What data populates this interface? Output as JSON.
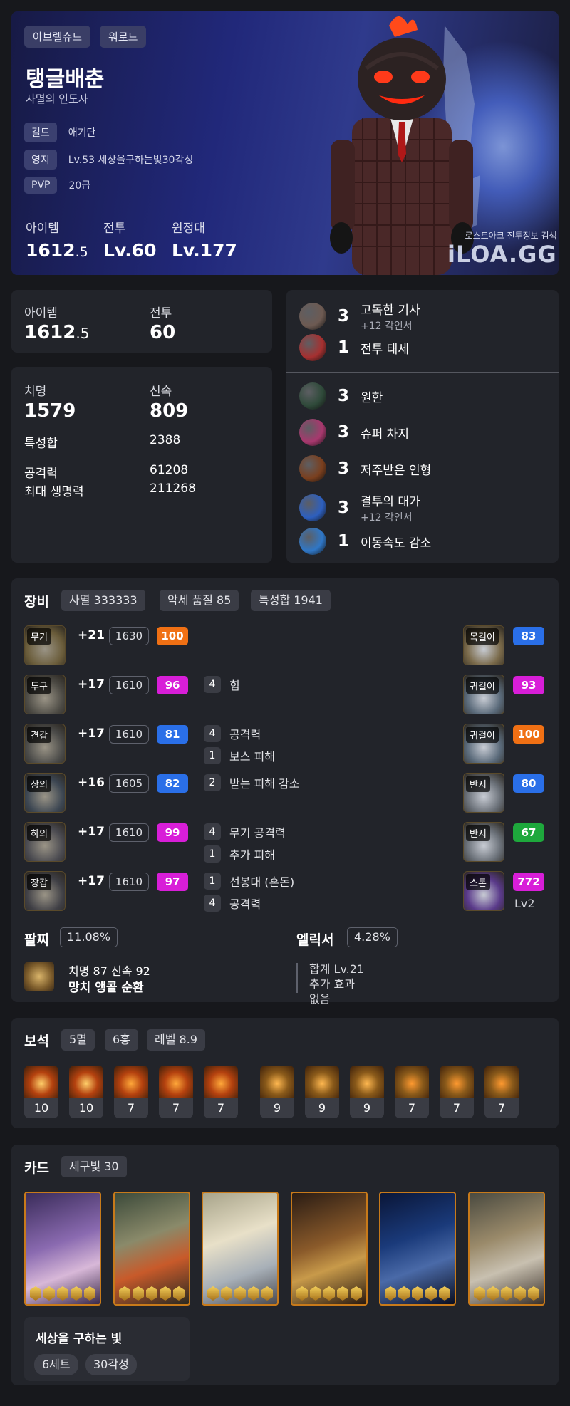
{
  "profile": {
    "server": "아브렐슈드",
    "class": "워로드",
    "name": "탱글배춘",
    "title": "사멸의 인도자",
    "rows": [
      {
        "key": "길드",
        "value": "애기단"
      },
      {
        "key": "영지",
        "value": "Lv.53 세상을구하는빛30각성"
      },
      {
        "key": "PVP",
        "value": "20급"
      }
    ],
    "stats": [
      {
        "label": "아이템",
        "main": "1612",
        "frac": ".5"
      },
      {
        "label": "전투",
        "main": "Lv.60",
        "frac": ""
      },
      {
        "label": "원정대",
        "main": "Lv.177",
        "frac": ""
      }
    ],
    "brand_sub": "로스트아크 전투정보 검색",
    "brand": "iLOA.GG"
  },
  "level_panel": {
    "item_label": "아이템",
    "item_main": "1612",
    "item_frac": ".5",
    "combat_label": "전투",
    "combat_value": "60"
  },
  "stat_panel": {
    "crit_label": "치명",
    "crit": "1579",
    "swift_label": "신속",
    "swift": "809",
    "rows": [
      {
        "label": "특성합",
        "value": "2388"
      },
      {
        "label": "공격력",
        "value": "61208"
      },
      {
        "label": "최대 생명력",
        "value": "211268"
      }
    ]
  },
  "engravings": {
    "top": [
      {
        "level": "3",
        "name": "고독한 기사",
        "extra": "+12 각인서",
        "icon": "knight-portrait-icon",
        "color": "#6d5a52"
      },
      {
        "level": "1",
        "name": "전투 태세",
        "extra": "",
        "icon": "shield-icon",
        "color": "#a63030"
      }
    ],
    "bottom": [
      {
        "level": "3",
        "name": "원한",
        "extra": "",
        "icon": "grudge-icon",
        "color": "#2f4a3a"
      },
      {
        "level": "3",
        "name": "슈퍼 차지",
        "extra": "",
        "icon": "super-charge-icon",
        "color": "#a8386e"
      },
      {
        "level": "3",
        "name": "저주받은 인형",
        "extra": "",
        "icon": "cursed-doll-icon",
        "color": "#7a3f1e"
      },
      {
        "level": "3",
        "name": "결투의 대가",
        "extra": "+12 각인서",
        "icon": "duel-icon",
        "color": "#2d5fbf"
      },
      {
        "level": "1",
        "name": "이동속도 감소",
        "extra": "",
        "icon": "speed-down-icon",
        "color": "#2f77c7"
      }
    ]
  },
  "equipment": {
    "title": "장비",
    "tags": [
      "사멸 333333",
      "악세 품질 85",
      "특성합 1941"
    ],
    "items": [
      {
        "slot": "무기",
        "refine": "+21",
        "ilvl": "1630",
        "quality": "100",
        "qcolor": "#f07014",
        "icon": "weapon-icon",
        "opts": []
      },
      {
        "slot": "투구",
        "refine": "+17",
        "ilvl": "1610",
        "quality": "96",
        "qcolor": "#d81ed8",
        "icon": "helmet-icon",
        "opts": [
          {
            "count": "4",
            "text": "힘"
          }
        ]
      },
      {
        "slot": "견갑",
        "refine": "+17",
        "ilvl": "1610",
        "quality": "81",
        "qcolor": "#2a6fe8",
        "icon": "shoulder-icon",
        "opts": [
          {
            "count": "4",
            "text": "공격력"
          },
          {
            "count": "1",
            "text": "보스 피해"
          }
        ]
      },
      {
        "slot": "상의",
        "refine": "+16",
        "ilvl": "1605",
        "quality": "82",
        "qcolor": "#2a6fe8",
        "icon": "chest-icon",
        "opts": [
          {
            "count": "2",
            "text": "받는 피해 감소"
          }
        ]
      },
      {
        "slot": "하의",
        "refine": "+17",
        "ilvl": "1610",
        "quality": "99",
        "qcolor": "#d81ed8",
        "icon": "pants-icon",
        "opts": [
          {
            "count": "4",
            "text": "무기 공격력"
          },
          {
            "count": "1",
            "text": "추가 피해"
          }
        ]
      },
      {
        "slot": "장갑",
        "refine": "+17",
        "ilvl": "1610",
        "quality": "97",
        "qcolor": "#d81ed8",
        "icon": "gloves-icon",
        "opts": [
          {
            "count": "1",
            "text": "선봉대 (혼돈)"
          },
          {
            "count": "4",
            "text": "공격력"
          }
        ]
      }
    ],
    "accessories": [
      {
        "slot": "목걸이",
        "quality": "83",
        "qcolor": "#2a6fe8",
        "icon": "necklace-icon"
      },
      {
        "slot": "귀걸이",
        "quality": "93",
        "qcolor": "#d81ed8",
        "icon": "earring-icon"
      },
      {
        "slot": "귀걸이",
        "quality": "100",
        "qcolor": "#f07014",
        "icon": "earring-icon"
      },
      {
        "slot": "반지",
        "quality": "80",
        "qcolor": "#2a6fe8",
        "icon": "ring-icon"
      },
      {
        "slot": "반지",
        "quality": "67",
        "qcolor": "#1ea83c",
        "icon": "ring-icon"
      },
      {
        "slot": "스톤",
        "quality": "772",
        "qcolor": "#d81ed8",
        "icon": "stone-icon",
        "extra": "Lv2"
      }
    ]
  },
  "bracelet": {
    "label": "팔찌",
    "pct": "11.08%",
    "line1": "치명 87  신속 92",
    "line2": "망치  앵콜  순환"
  },
  "elixir": {
    "label": "엘릭서",
    "pct": "4.28%",
    "line1": "합계 Lv.21",
    "line2": "추가 효과",
    "line3": "없음"
  },
  "gems": {
    "title": "보석",
    "tags": [
      "5멸",
      "6홍",
      "레벨 8.9"
    ],
    "items": [
      "10",
      "10",
      "7",
      "7",
      "7",
      "9",
      "9",
      "9",
      "7",
      "7",
      "7"
    ]
  },
  "cards": {
    "title": "카드",
    "tag": "세구빛 30",
    "set_name": "세상을 구하는 빛",
    "set_tags": [
      "6세트",
      "30각성"
    ],
    "awaken": [
      5,
      5,
      5,
      5,
      5,
      5
    ]
  }
}
